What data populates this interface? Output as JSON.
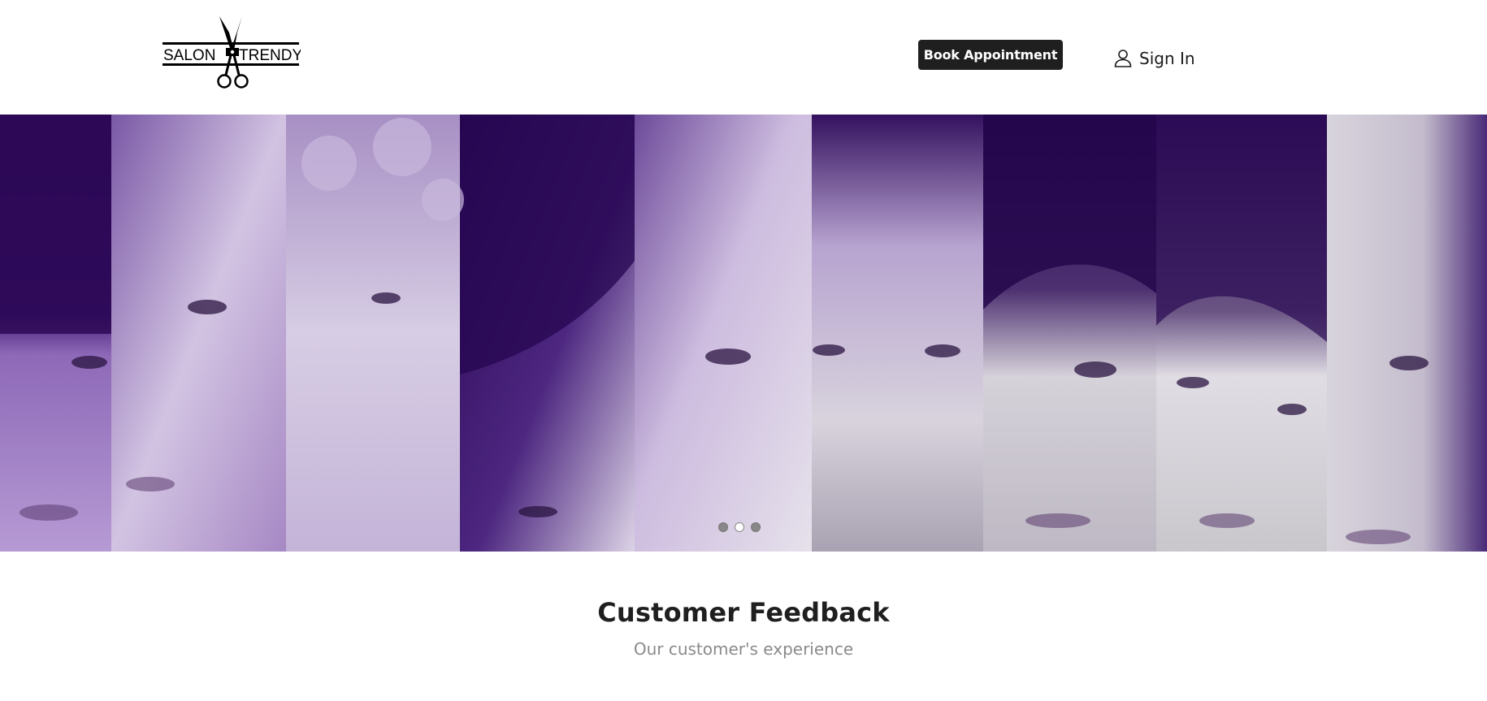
{
  "header": {
    "logo": {
      "left_text": "SALON",
      "right_text": "TRENDY",
      "icon": "scissors-icon"
    },
    "book_button_label": "Book Appointment",
    "signin_label": "Sign In",
    "signin_icon": "user-icon"
  },
  "carousel": {
    "slide_count": 3,
    "active_slide": 2,
    "tint_color": "#3b1466"
  },
  "feedback": {
    "title": "Customer Feedback",
    "subtitle": "Our customer's experience"
  }
}
